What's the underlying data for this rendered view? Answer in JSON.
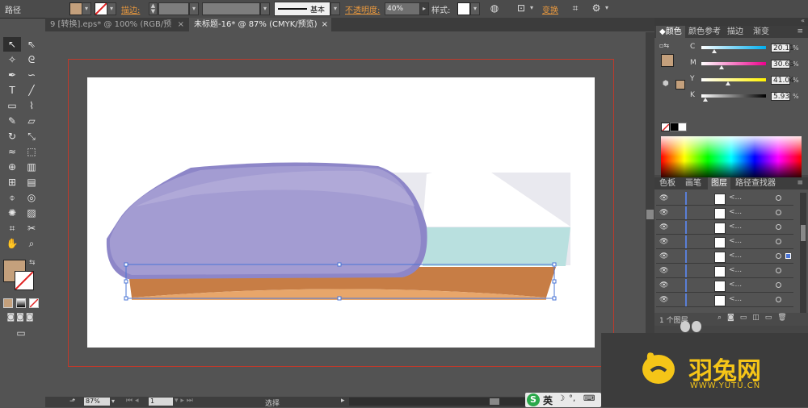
{
  "control_bar": {
    "label_path": "路径",
    "stroke_label": "描边:",
    "stroke_style": "基本",
    "opacity_label": "不透明度:",
    "opacity_value": "40%",
    "style_label": "样式:",
    "transform_label": "变换",
    "fill_color": "#c4a07c",
    "ctrl_icons": [
      "fill-dropdown-icon",
      "stroke-none-icon",
      "recolor-icon",
      "isolate-icon",
      "transform-icon",
      "align-icon"
    ]
  },
  "tabs": [
    {
      "label": "9 [转换].eps* @ 100% (RGB/预览)",
      "close": "×"
    },
    {
      "label": "未标题-16* @ 87% (CMYK/预览)",
      "close": "×"
    }
  ],
  "tools": [
    [
      "selection-tool",
      "direct-selection-tool"
    ],
    [
      "magic-wand-tool",
      "lasso-tool"
    ],
    [
      "pen-tool",
      "curvature-tool"
    ],
    [
      "type-tool",
      "line-tool"
    ],
    [
      "rectangle-tool",
      "paintbrush-tool"
    ],
    [
      "pencil-tool",
      "eraser-tool"
    ],
    [
      "rotate-tool",
      "scale-tool"
    ],
    [
      "warp-tool",
      "free-transform-tool"
    ],
    [
      "shape-builder-tool",
      "chart-tool"
    ],
    [
      "mesh-tool",
      "gradient-tool"
    ],
    [
      "eyedropper-tool",
      "blend-tool"
    ],
    [
      "symbol-sprayer-tool",
      "column-graph-tool"
    ],
    [
      "artboard-tool",
      "slice-tool"
    ],
    [
      "hand-tool",
      "zoom-tool"
    ]
  ],
  "status": {
    "zoom": "87%",
    "page": "1",
    "mode": "选择"
  },
  "color_panel": {
    "tabs": [
      "颜色",
      "颜色参考",
      "描边",
      "渐变"
    ],
    "fill_color": "#c4a07c",
    "channels": [
      {
        "label": "C",
        "value": "20.11",
        "unit": "%",
        "fraction": 0.2011,
        "gradient": "linear-gradient(to right,#fff,#00aeef)"
      },
      {
        "label": "M",
        "value": "30.63",
        "unit": "%",
        "fraction": 0.3063,
        "gradient": "linear-gradient(to right,#fff,#ec008c)"
      },
      {
        "label": "Y",
        "value": "41.04",
        "unit": "%",
        "fraction": 0.4104,
        "gradient": "linear-gradient(to right,#fff,#fff200)"
      },
      {
        "label": "K",
        "value": "5.93",
        "unit": "%",
        "fraction": 0.0593,
        "gradient": "linear-gradient(to right,#fff,#000)"
      }
    ]
  },
  "layers_panel": {
    "tabs": [
      "色板",
      "画笔",
      "图层",
      "路径查找器"
    ],
    "row_name": "<...",
    "row_count": 8,
    "footer": "1 个图层"
  },
  "taskbar": {
    "ime_label": "英",
    "ime_icons": [
      "moon-icon",
      "punctuation-icon",
      "keyboard-icon"
    ]
  },
  "watermark": {
    "name": "羽兔网",
    "url": "WWW.YUTU.CN",
    "color": "#f5c518"
  }
}
